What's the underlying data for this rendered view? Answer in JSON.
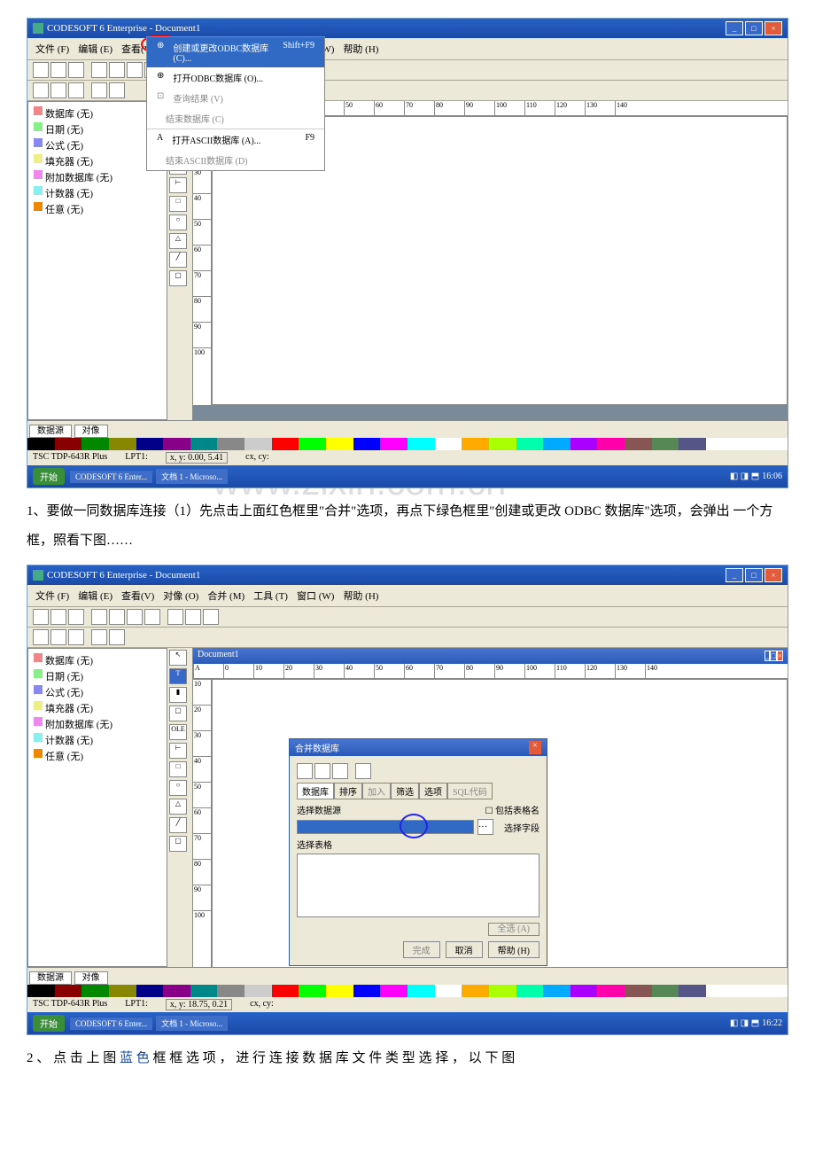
{
  "app_title": "CODESOFT 6 Enterprise - Document1",
  "menubar": {
    "file": "文件 (F)",
    "edit": "编辑 (E)",
    "view": "查看(V)",
    "obj": "对像 (O)",
    "merge": "合并 (M)",
    "tool": "工具 (T)",
    "win": "窗口 (W)",
    "help": "帮助 (H)"
  },
  "dropdown": {
    "i1": "创建或更改ODBC数据库 (C)...",
    "i1s": "Shift+F9",
    "i2": "打开ODBC数据库 (O)...",
    "i3": "查询结果 (V)",
    "i4": "结束数据库 (C)",
    "i5": "打开ASCII数据库 (A)...",
    "i5s": "F9",
    "i6": "结束ASCII数据库 (D)"
  },
  "sidebar": {
    "h": "数据库   (无)",
    "d": "日期 (无)",
    "f": "公式 (无)",
    "fl": "填充器 (无)",
    "a": "附加数据库 (无)",
    "c": "计数器 (无)",
    "r": "任意 (无)"
  },
  "sidetabs": {
    "a": "数据源",
    "b": "对像"
  },
  "doc_title": "Document1",
  "ruler": [
    "0",
    "10",
    "20",
    "30",
    "40",
    "50",
    "60",
    "70",
    "80",
    "90",
    "100",
    "110",
    "120",
    "130",
    "140"
  ],
  "rulerv": [
    "10",
    "20",
    "30",
    "40",
    "50",
    "60",
    "70",
    "80",
    "90",
    "100"
  ],
  "status": {
    "printer": "TSC TDP-643R Plus",
    "port": "LPT1:",
    "xy1": "x, y: 0.00, 5.41",
    "xy2": "x, y: 18.75, 0.21",
    "cxcy": "cx, cy:"
  },
  "taskbar": {
    "start": "开始",
    "t1": "CODESOFT 6 Enter...",
    "t2": "文档 1 - Microso...",
    "time1": "16:06",
    "time2": "16:22"
  },
  "para1": "1、要做一同数据库连接（1）先点击上面红色框里\"合并\"选项，再点下绿色框里\"创建或更改 ODBC 数据库\"选项，会弹出 一个方框，照看下图……",
  "para2_a": "2 、 点 击 上 图 ",
  "para2_b": "蓝 色",
  "para2_c": " 框 框 选 项 ， 进 行 连 接 数 据 库 文 件 类 型 选 择 ， 以 下 图",
  "wm": "www.zixin.com.cn",
  "dlg": {
    "title": "合并数据库",
    "tab1": "数据库",
    "tab2": "排序",
    "tab3": "加入",
    "tab4": "筛选",
    "tab5": "选项",
    "tab6": "SQL代码",
    "l1": "选择数据源",
    "l2": "包括表格名",
    "l3": "选择字段",
    "l4": "选择表格",
    "b1": "全选 (A)",
    "b2": "完成",
    "b3": "取消",
    "b4": "帮助 (H)"
  },
  "tools": {
    "ole": "OLE"
  }
}
